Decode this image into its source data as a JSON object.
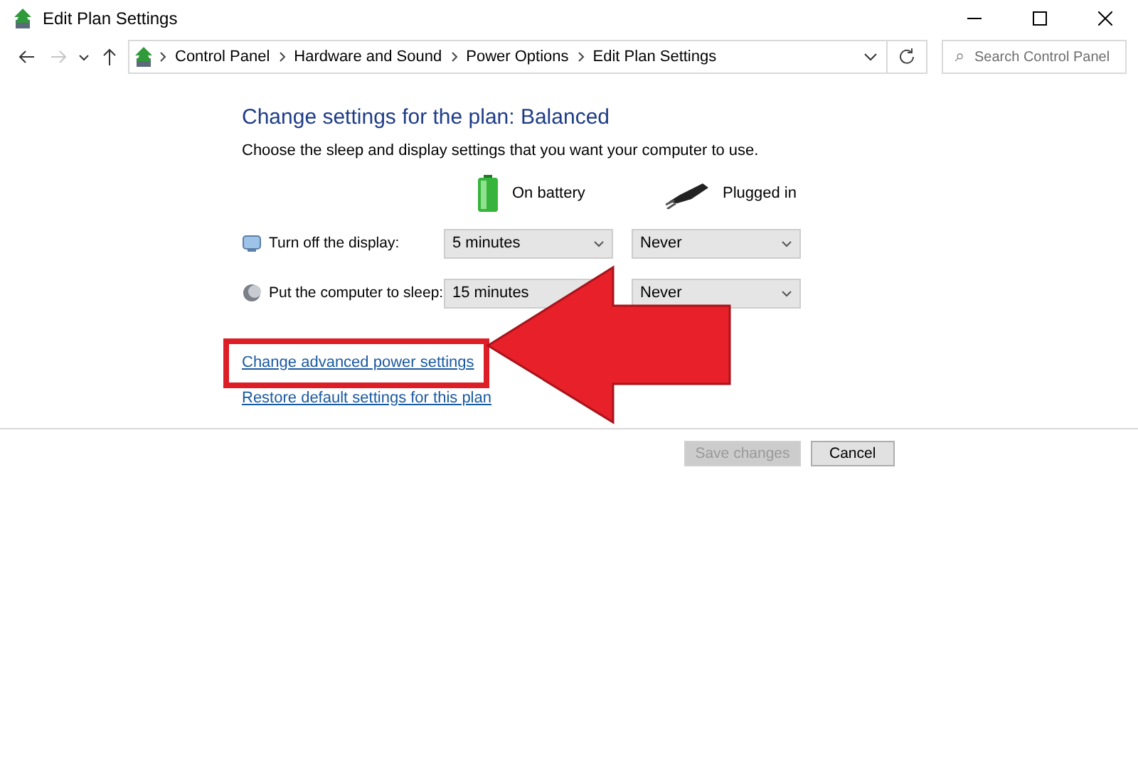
{
  "window": {
    "title": "Edit Plan Settings"
  },
  "navigation": {
    "back_disabled": false,
    "forward_disabled": true
  },
  "breadcrumbs": [
    "Control Panel",
    "Hardware and Sound",
    "Power Options",
    "Edit Plan Settings"
  ],
  "search": {
    "placeholder": "Search Control Panel"
  },
  "heading": "Change settings for the plan: Balanced",
  "description": "Choose the sleep and display settings that you want your computer to use.",
  "columns": [
    {
      "label": "On battery",
      "kind": "battery"
    },
    {
      "label": "Plugged in",
      "kind": "plug"
    }
  ],
  "settings": [
    {
      "label": "Turn off the display:",
      "kind": "display",
      "values": [
        "5 minutes",
        "Never"
      ]
    },
    {
      "label": "Put the computer to sleep:",
      "kind": "sleep",
      "values": [
        "15 minutes",
        "Never"
      ]
    }
  ],
  "links": [
    {
      "text": "Change advanced power settings",
      "highlighted": true
    },
    {
      "text": "Restore default settings for this plan",
      "highlighted": false
    }
  ],
  "buttons": [
    {
      "label": "Save changes",
      "disabled": true
    },
    {
      "label": "Cancel",
      "disabled": false
    }
  ],
  "annotations": [
    {
      "kind": "arrow"
    }
  ]
}
